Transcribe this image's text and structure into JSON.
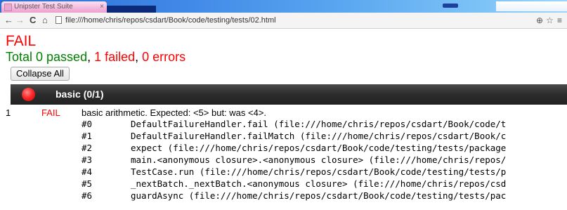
{
  "browser": {
    "tab_title": "Unipster Test Suite",
    "url": "file:///home/chris/repos/csdart/Book/code/testing/tests/02.html",
    "nav": {
      "back": "←",
      "forward": "→",
      "reload": "C",
      "home": "⌂"
    }
  },
  "page": {
    "status": "FAIL",
    "summary": {
      "total_passed": "Total 0 passed",
      "sep1": ", ",
      "failed": "1 failed",
      "sep2": ", ",
      "errors": "0 errors"
    },
    "collapse_button": "Collapse All",
    "group": {
      "title": "basic (0/1)",
      "status_color": "#ff2a2a"
    },
    "result": {
      "number": "1",
      "status": "FAIL",
      "message": "basic arithmetic. Expected: <5> but: was <4>."
    },
    "stack": [
      {
        "idx": "#0",
        "text": "DefaultFailureHandler.fail (file:///home/chris/repos/csdart/Book/code/t"
      },
      {
        "idx": "#1",
        "text": "DefaultFailureHandler.failMatch (file:///home/chris/repos/csdart/Book/c"
      },
      {
        "idx": "#2",
        "text": "expect (file:///home/chris/repos/csdart/Book/code/testing/tests/package"
      },
      {
        "idx": "#3",
        "text": "main.<anonymous closure>.<anonymous closure> (file:///home/chris/repos/"
      },
      {
        "idx": "#4",
        "text": "TestCase.run (file:///home/chris/repos/csdart/Book/code/testing/tests/p"
      },
      {
        "idx": "#5",
        "text": "_nextBatch._nextBatch.<anonymous closure> (file:///home/chris/repos/csd"
      },
      {
        "idx": "#6",
        "text": "guardAsync (file:///home/chris/repos/csdart/Book/code/testing/tests/pac"
      }
    ]
  },
  "colors": {
    "fail_red": "#ff0000",
    "pass_green": "#008000",
    "header_dark": "#2c2c2c"
  },
  "icons": [
    "back-arrow-icon",
    "forward-arrow-icon",
    "reload-icon",
    "home-icon",
    "page-icon",
    "zoom-icon",
    "star-icon",
    "menu-icon"
  ]
}
